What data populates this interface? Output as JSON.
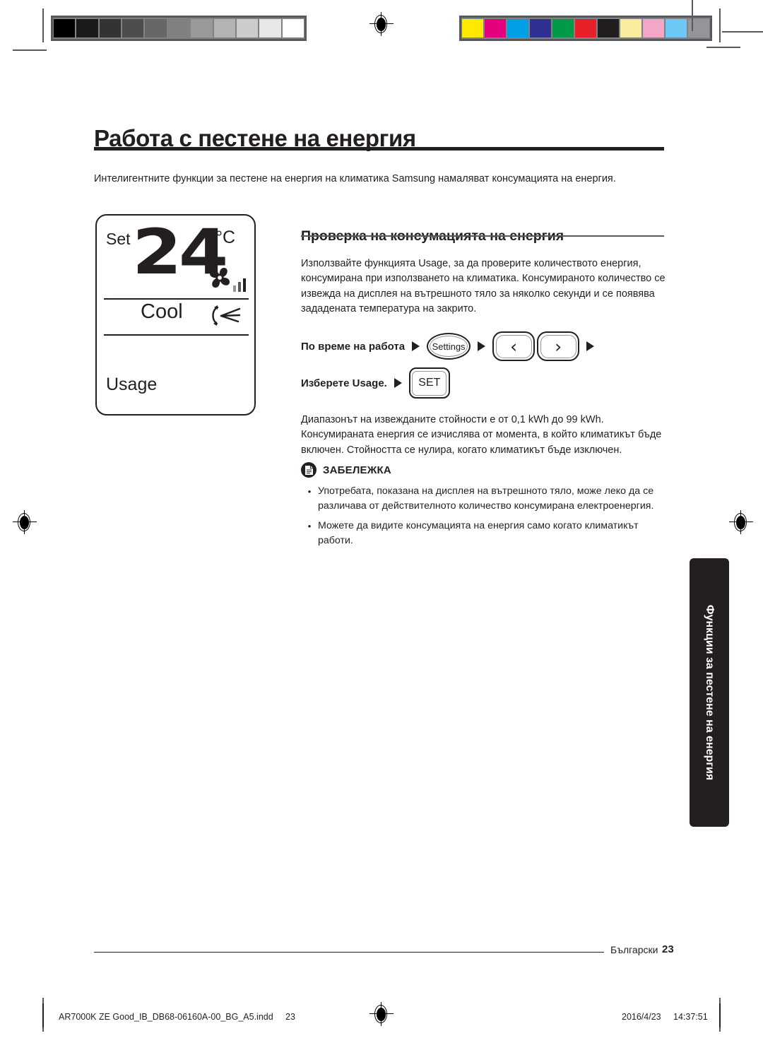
{
  "print_marks": {
    "grayscale_swatches": [
      "#000000",
      "#1b1b1b",
      "#333333",
      "#4d4d4d",
      "#666666",
      "#808080",
      "#999999",
      "#b3b3b3",
      "#cccccc",
      "#e8e8e8",
      "#ffffff"
    ],
    "color_swatches": [
      "#ffe900",
      "#e5007e",
      "#00a0e4",
      "#2e3192",
      "#009a49",
      "#e8202a",
      "#211d1e",
      "#faeca0",
      "#f4a6c8",
      "#6ec8f5",
      "#939598"
    ],
    "registration_icon": "registration-target-icon"
  },
  "page": {
    "title": "Работа с пестене на енергия",
    "intro": "Интелигентните функции за пестене на енергия на климатика Samsung намаляват консумацията на енергия."
  },
  "lcd": {
    "set_label": "Set",
    "temperature": "24",
    "unit": "°C",
    "mode": "Cool",
    "usage_label": "Usage",
    "fan_icon": "fan-speed-icon",
    "swing_icon": "air-swing-icon"
  },
  "section": {
    "heading": "Проверка на консумацията на енергия",
    "body": "Използвайте функцията Usage, за да проверите количеството енергия, консумирана при използването на климатика. Консумираното количество се извежда на дисплея на вътрешното тяло за няколко секунди и се появява зададената температура на закрито."
  },
  "steps": [
    {
      "label": "По време на работа",
      "buttons": [
        {
          "type": "oval",
          "text": "Settings",
          "icon": "settings-button"
        },
        {
          "type": "rect",
          "text": "‹",
          "icon": "chevron-left-icon"
        },
        {
          "type": "rect",
          "text": "›",
          "icon": "chevron-right-icon"
        }
      ],
      "trailing_arrow": true
    },
    {
      "label": "Изберете Usage.",
      "buttons": [
        {
          "type": "set",
          "text": "SET",
          "icon": "set-button"
        }
      ],
      "trailing_arrow": false
    }
  ],
  "post_steps": "Диапазонът на извежданите стойности е от 0,1 kWh до 99 kWh. Консумираната енергия се изчислява от момента, в който климатикът бъде включен. Стойността се нулира, когато климатикът бъде изключен.",
  "note": {
    "icon": "note-document-icon",
    "title": "ЗАБЕЛЕЖКА",
    "bullet": "•",
    "items": [
      "Употребата, показана на дисплея на вътрешното тяло, може леко да се различава от действителното количество консумирана електроенергия.",
      "Можете да видите консумацията на енергия само когато климатикът работи."
    ]
  },
  "side_tab": {
    "label": "Функции за пестене на енергия"
  },
  "footer": {
    "language": "Български",
    "page_number": "23"
  },
  "slug": {
    "filename": "AR7000K ZE Good_IB_DB68-06160A-00_BG_A5.indd",
    "page": "23",
    "date": "2016/4/23",
    "time": "14:37:51"
  }
}
